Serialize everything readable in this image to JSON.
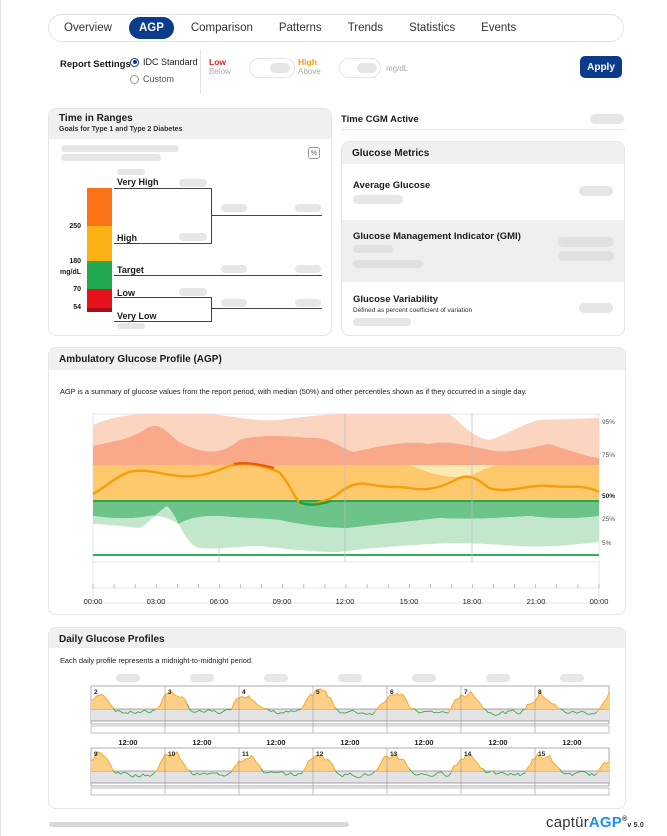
{
  "tabs": [
    {
      "label": "Overview",
      "active": false
    },
    {
      "label": "AGP",
      "active": true
    },
    {
      "label": "Comparison",
      "active": false
    },
    {
      "label": "Patterns",
      "active": false
    },
    {
      "label": "Trends",
      "active": false
    },
    {
      "label": "Statistics",
      "active": false
    },
    {
      "label": "Events",
      "active": false
    }
  ],
  "settings": {
    "title": "Report Settings",
    "option_standard": "IDC Standard",
    "option_custom": "Custom",
    "low_label": "Low",
    "low_sub": "Below",
    "high_label": "High",
    "high_sub": "Above",
    "unit": "mg/dL",
    "apply_label": "Apply"
  },
  "tir": {
    "title": "Time in Ranges",
    "subtitle": "Goals for Type 1 and Type 2 Diabetes",
    "percent_icon": "%",
    "ranges": {
      "very_high": "Very High",
      "high": "High",
      "target": "Target",
      "low": "Low",
      "very_low": "Very Low"
    },
    "thresholds": {
      "t250": "250",
      "t180": "180",
      "unit": "mg/dL",
      "t70": "70",
      "t54": "54"
    },
    "colors": {
      "very_high": "#f97316",
      "high": "#fbb014",
      "target": "#22a94f",
      "low": "#e8121c",
      "very_low": "#a3101a"
    }
  },
  "cgm": {
    "title": "Time CGM Active"
  },
  "metrics": {
    "title": "Glucose Metrics",
    "avg": "Average Glucose",
    "gmi": "Glucose Management Indicator (GMI)",
    "gv": "Glucose Variability",
    "gv_sub": "Defined as percent coefficient of variation"
  },
  "agp": {
    "title": "Ambulatory Glucose Profile (AGP)",
    "description": "AGP is a summary of glucose values from the report period, with median (50%) and other percentiles shown as if they occurred in a single day.",
    "percentile_labels": [
      "95%",
      "75%",
      "50%",
      "25%",
      "5%"
    ],
    "time_labels": [
      "00:00",
      "03:00",
      "06:00",
      "09:00",
      "12:00",
      "15:00",
      "18:00",
      "21:00",
      "00:00"
    ],
    "colors": {
      "outer_high": "#fcd5c0",
      "inner_high": "#f9a98a",
      "target_band": "#fdc96c",
      "median": "#f59e0b",
      "median_high": "#ea580c",
      "median_target": "#16a34a",
      "inner_low": "#6cc48a",
      "outer_low": "#c3e7cb",
      "target_line": "#16a34a"
    }
  },
  "daily": {
    "title": "Daily Glucose Profiles",
    "description": "Each daily profile represents a midnight-to-midnight period.",
    "week1_days": [
      "2",
      "3",
      "4",
      "5",
      "6",
      "7",
      "8"
    ],
    "week2_days": [
      "9",
      "10",
      "11",
      "12",
      "13",
      "14",
      "15"
    ],
    "noon_label": "12:00"
  },
  "brand": {
    "name_light": "captür",
    "name_bold": "AGP",
    "reg": "®",
    "version": "v 5.0"
  }
}
